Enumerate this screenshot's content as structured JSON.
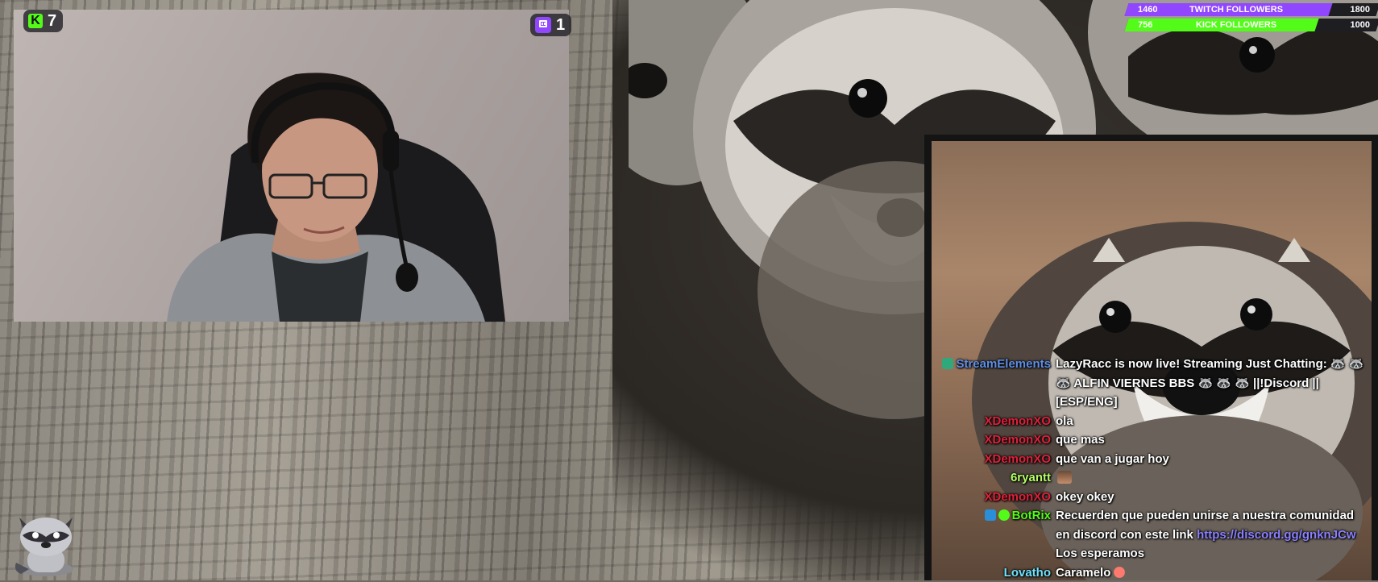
{
  "kick_badge": {
    "icon": "kick-logo-icon",
    "letter": "K",
    "count": "7"
  },
  "twitch_badge": {
    "icon": "twitch-logo-icon",
    "count": "1"
  },
  "follower_goals": [
    {
      "current": "1460",
      "label": "TWITCH FOLLOWERS",
      "goal": "1800",
      "progress": 0.811,
      "color": "#9146ff"
    },
    {
      "current": "756",
      "label": "KICK FOLLOWERS",
      "goal": "1000",
      "progress": 0.756,
      "color": "#53fc18"
    }
  ],
  "chat": {
    "messages": [
      {
        "user": "StreamElements",
        "color": "#5f8fe6",
        "badge": "streamelements-icon",
        "text": "LazyRacc is now live! Streaming Just Chatting: 🦝 🦝 🦝 ALFIN VIERNES BBS 🦝 🦝 🦝 ||!Discord || [ESP/ENG]"
      },
      {
        "user": "XDemonXO",
        "color": "#e0203a",
        "text": "ola"
      },
      {
        "user": "XDemonXO",
        "color": "#e0203a",
        "text": "que mas"
      },
      {
        "user": "XDemonXO",
        "color": "#e0203a",
        "text": "que van a jugar hoy"
      },
      {
        "user": "6ryantt",
        "color": "#b6ff64",
        "text": "",
        "emote": "face-emote-icon"
      },
      {
        "user": "XDemonXO",
        "color": "#e0203a",
        "text": "okey okey"
      },
      {
        "user": "BotRix",
        "color": "#53fc18",
        "badge": "bot-badge-icon",
        "text": "Recuerden que pueden unirse a nuestra comunidad en discord con este link",
        "link": "https://discord.gg/gnknJCw",
        "after": "Los esperamos"
      },
      {
        "user": "Lovatho",
        "color": "#6fe3ff",
        "text": "Caramelo",
        "emote": "heart-emote-icon"
      }
    ]
  },
  "mascot": {
    "icon": "raccoon-mascot-icon"
  }
}
